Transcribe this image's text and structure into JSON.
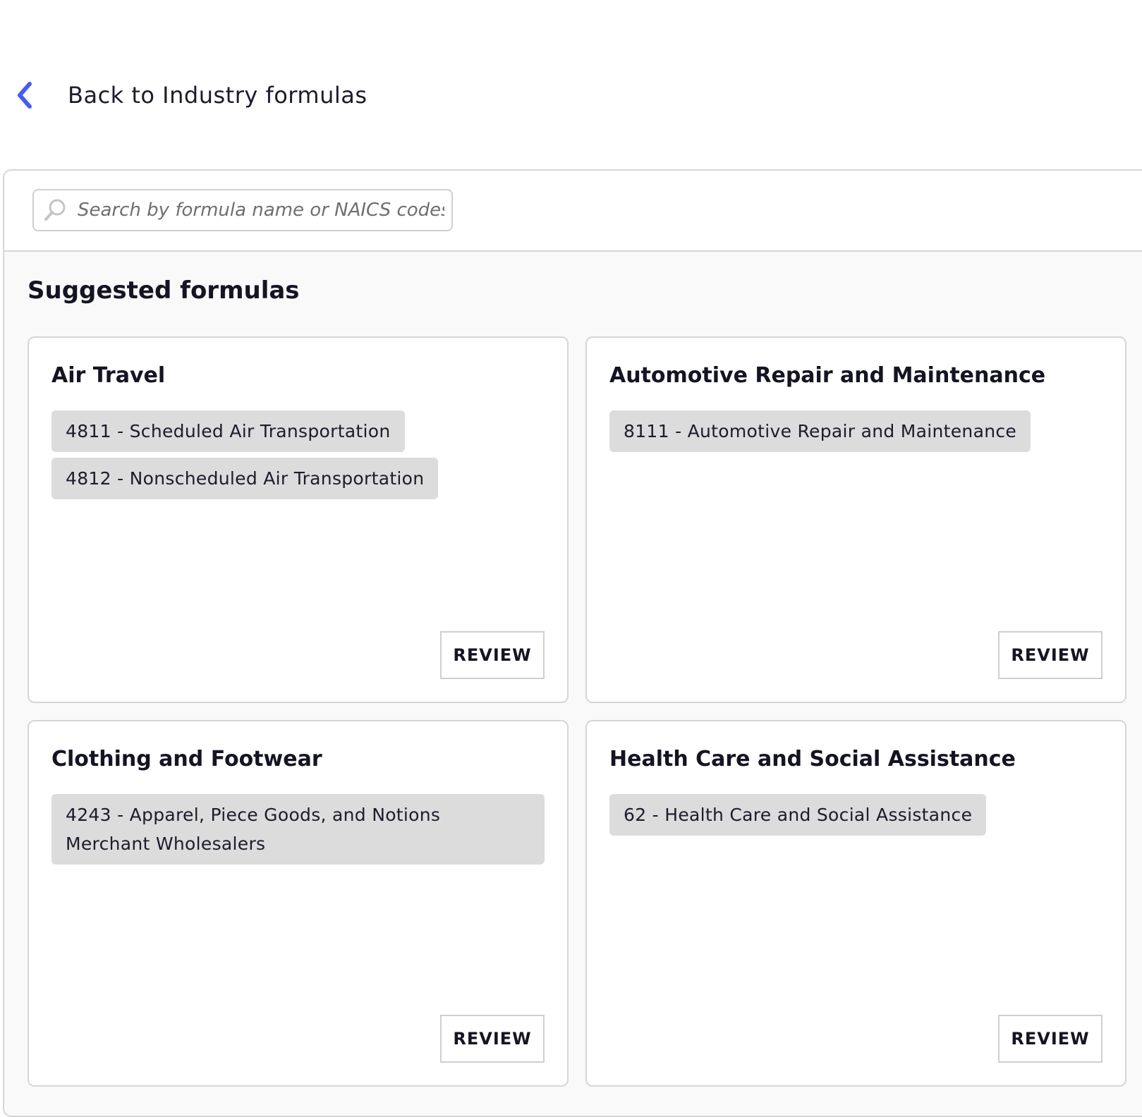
{
  "back_link": {
    "label": "Back to Industry formulas",
    "icon": "chevron-left-icon",
    "icon_color": "#4a5cf0"
  },
  "search": {
    "placeholder": "Search by formula name or NAICS codes",
    "value": "",
    "icon": "search-icon"
  },
  "section_title": "Suggested formulas",
  "cards": [
    {
      "title": "Air Travel",
      "tags": [
        "4811 - Scheduled Air Transportation",
        "4812 - Nonscheduled Air Transportation"
      ],
      "button_label": "REVIEW"
    },
    {
      "title": "Automotive Repair and Maintenance",
      "tags": [
        "8111 - Automotive Repair and Maintenance"
      ],
      "button_label": "REVIEW"
    },
    {
      "title": "Clothing and Footwear",
      "tags": [
        "4243 - Apparel, Piece Goods, and Notions Merchant Wholesalers"
      ],
      "button_label": "REVIEW"
    },
    {
      "title": "Health Care and Social Assistance",
      "tags": [
        "62 - Health Care and Social Assistance"
      ],
      "button_label": "REVIEW"
    }
  ],
  "colors": {
    "accent": "#4a5cf0",
    "tag_bg": "#dcdcdc",
    "panel_bg": "#f9f9f9",
    "border": "#d6d6d6"
  }
}
